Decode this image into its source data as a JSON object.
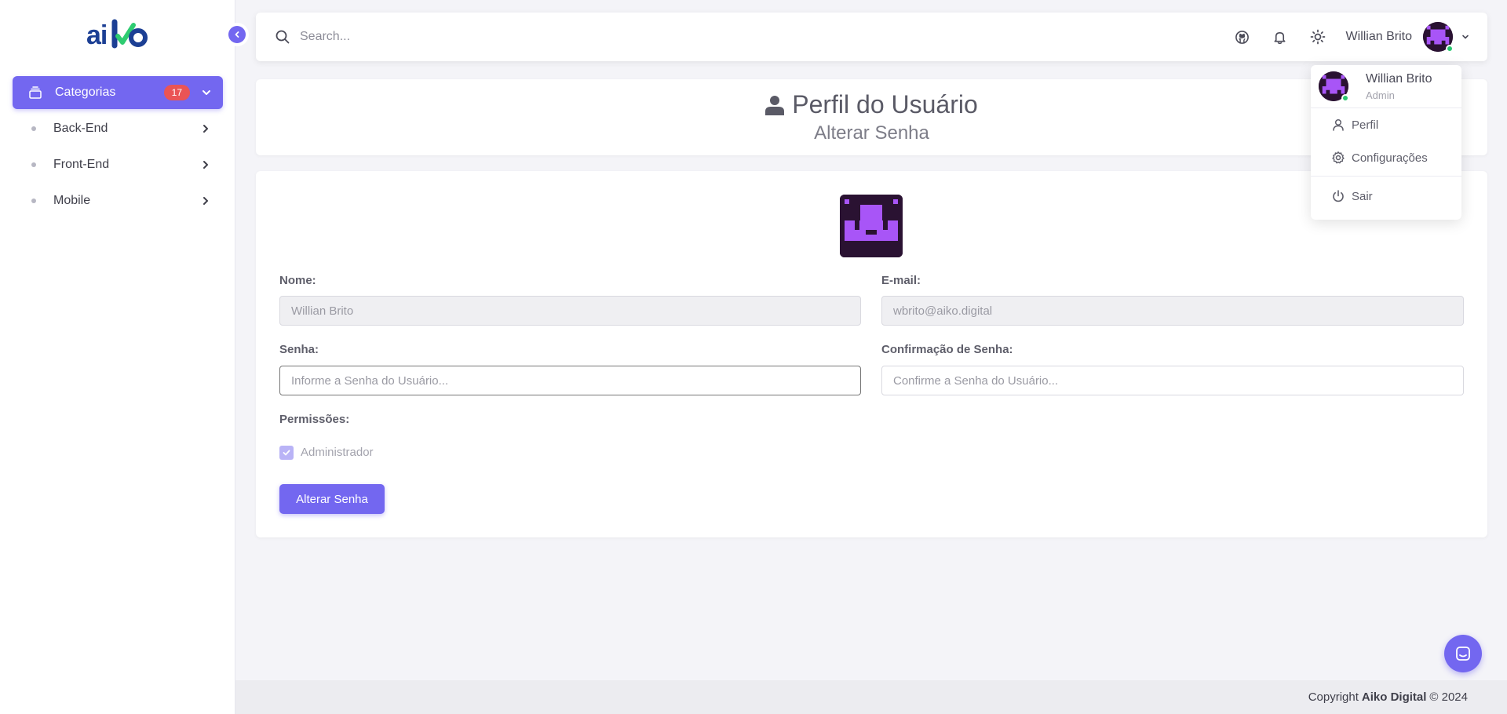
{
  "app": {
    "logo_text": "aiko"
  },
  "colors": {
    "accent": "#7367f0",
    "badge": "#ea5455",
    "online": "#28c76f"
  },
  "sidebar": {
    "category": {
      "label": "Categorias",
      "count": "17",
      "icon": "stack-icon"
    },
    "items": [
      {
        "label": "Back-End"
      },
      {
        "label": "Front-End"
      },
      {
        "label": "Mobile"
      }
    ]
  },
  "topbar": {
    "search_placeholder": "Search...",
    "icons": [
      "github-icon",
      "bell-icon",
      "sun-icon"
    ],
    "user_name": "Willian Brito"
  },
  "dropdown": {
    "name": "Willian Brito",
    "role": "Admin",
    "items": [
      {
        "label": "Perfil",
        "icon": "user-icon"
      },
      {
        "label": "Configurações",
        "icon": "gear-icon"
      },
      {
        "label": "Sair",
        "icon": "power-icon"
      }
    ]
  },
  "page": {
    "title": "Perfil do Usuário",
    "subtitle": "Alterar Senha"
  },
  "form": {
    "name_label": "Nome:",
    "name_value": "Willian Brito",
    "email_label": "E-mail:",
    "email_value": "wbrito@aiko.digital",
    "password_label": "Senha:",
    "password_placeholder": "Informe a Senha do Usuário...",
    "confirm_label": "Confirmação de Senha:",
    "confirm_placeholder": "Confirme a Senha do Usuário...",
    "permissions_label": "Permissões:",
    "admin_label": "Administrador",
    "admin_checked": true,
    "submit_label": "Alterar Senha"
  },
  "footer": {
    "prefix": "Copyright",
    "company": "Aiko Digital",
    "suffix": "© 2024"
  }
}
